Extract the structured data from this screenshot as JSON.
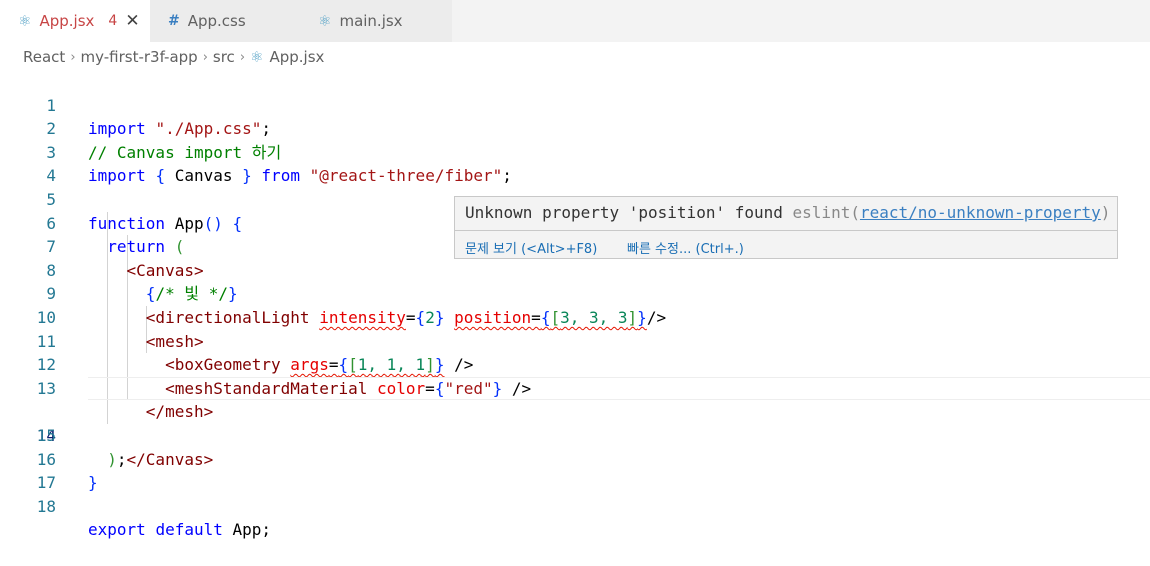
{
  "tabs": [
    {
      "label": "App.jsx",
      "badge": "4",
      "icon": "react-icon",
      "active": true
    },
    {
      "label": "App.css",
      "icon": "hash-icon",
      "active": false
    },
    {
      "label": "main.jsx",
      "icon": "react-icon",
      "active": false
    }
  ],
  "breadcrumb": [
    "React",
    "my-first-r3f-app",
    "src",
    "App.jsx"
  ],
  "line_numbers": [
    "1",
    "2",
    "3",
    "4",
    "5",
    "6",
    "7",
    "8",
    "9",
    "10",
    "11",
    "12",
    "13",
    "14",
    "15",
    "16",
    "17",
    "18"
  ],
  "code": {
    "l1_kw": "import",
    "l1_str": "\"./App.css\"",
    "l1_end": ";",
    "l2": "// Canvas import 하기",
    "l3_kw": "import",
    "l3_open": "{",
    "l3_id": " Canvas ",
    "l3_close": "}",
    "l3_from": "from",
    "l3_str": "\"@react-three/fiber\"",
    "l3_end": ";",
    "l5_kw": "function",
    "l5_name": "App",
    "l5_paren": "()",
    "l5_brace": "{",
    "l6_kw": "return",
    "l6_paren": "(",
    "l7": "<Canvas>",
    "l8_open": "{",
    "l8_cm": "/* 빛 */",
    "l8_close": "}",
    "l9_tag": "<directionalLight",
    "l9_a1": "intensity",
    "l9_eq1": "=",
    "l9_b1o": "{",
    "l9_n1": "2",
    "l9_b1c": "}",
    "l9_a2": "position",
    "l9_eq2": "=",
    "l9_b2o": "{",
    "l9_arr_o": "[",
    "l9_vals": "3, 3, 3",
    "l9_arr_c": "]",
    "l9_b2c": "}",
    "l9_end": "/>",
    "l10": "<mesh>",
    "l11_tag": "<boxGeometry",
    "l11_a": "args",
    "l11_eq": "=",
    "l11_bo": "{",
    "l11_ao": "[",
    "l11_vals": "1, 1, 1",
    "l11_ac": "]",
    "l11_bc": "}",
    "l11_end": "/>",
    "l12_tag": "<meshStandardMaterial",
    "l12_a": "color",
    "l12_eq": "=",
    "l12_bo": "{",
    "l12_str": "\"red\"",
    "l12_bc": "}",
    "l12_end": "/>",
    "l13": "</mesh>",
    "l14": "</Canvas>",
    "l15_paren": ")",
    "l15_end": ";",
    "l16": "}",
    "l18_kw1": "export",
    "l18_kw2": "default",
    "l18_id": "App",
    "l18_end": ";"
  },
  "hover": {
    "message": "Unknown property 'position' found",
    "source": "eslint(",
    "rule": "react/no-unknown-property",
    "source_close": ")",
    "action_view": "문제 보기 (<Alt>+F8)",
    "action_fix": "빠른 수정... (Ctrl+.)"
  },
  "colors": {
    "keyword": "#0000ff",
    "string": "#a31515",
    "comment": "#008000",
    "tag": "#800000",
    "attribute": "#e50000",
    "error": "#e51400"
  }
}
